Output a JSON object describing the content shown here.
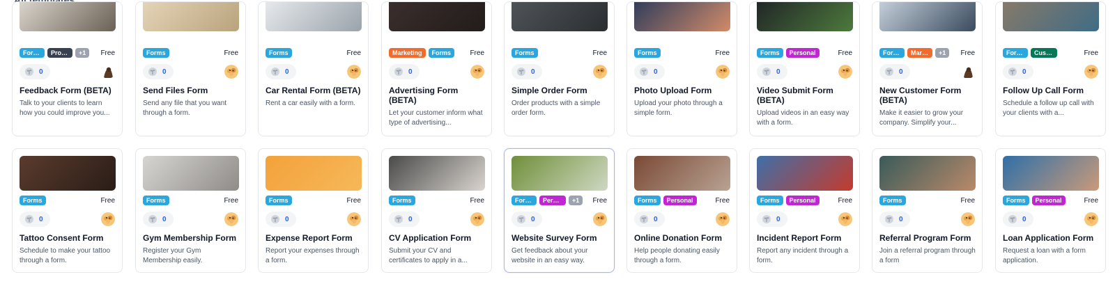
{
  "section_title": "All templates",
  "clone_icon": "sprout-icon",
  "rows": [
    {
      "cards": [
        {
          "name": "feedback-form",
          "title": "Feedback Form (BETA)",
          "desc": "Talk to your clients to learn how you could improve you...",
          "tags": [
            {
              "label": "Forms",
              "kind": "forms",
              "trunc": true
            },
            {
              "label": "Product",
              "kind": "product",
              "trunc": true
            },
            {
              "label": "+1",
              "kind": "more"
            }
          ],
          "price": "Free",
          "count": "0",
          "avatar": "dark",
          "thumb": [
            "#ded9d2",
            "#6b6154"
          ]
        },
        {
          "name": "send-files-form",
          "title": "Send Files Form",
          "desc": "Send any file that you want through a form.",
          "tags": [
            {
              "label": "Forms",
              "kind": "forms"
            }
          ],
          "price": "Free",
          "count": "0",
          "avatar": "dog",
          "thumb": [
            "#e6d6b9",
            "#b9a37d"
          ]
        },
        {
          "name": "car-rental-form",
          "title": "Car Rental Form (BETA)",
          "desc": "Rent a car easily with a form.",
          "tags": [
            {
              "label": "Forms",
              "kind": "forms"
            }
          ],
          "price": "Free",
          "count": "0",
          "avatar": "dog",
          "thumb": [
            "#e9ecef",
            "#9aa3ab"
          ]
        },
        {
          "name": "advertising-form",
          "title": "Advertising Form (BETA)",
          "desc": "Let your customer inform what type of advertising...",
          "tags": [
            {
              "label": "Marketing",
              "kind": "marketing"
            },
            {
              "label": "Forms",
              "kind": "forms"
            }
          ],
          "price": "Free",
          "count": "0",
          "avatar": "dog",
          "thumb": [
            "#3b2f2c",
            "#221c1a"
          ]
        },
        {
          "name": "simple-order-form",
          "title": "Simple Order Form",
          "desc": "Order products with a simple order form.",
          "tags": [
            {
              "label": "Forms",
              "kind": "forms"
            }
          ],
          "price": "Free",
          "count": "0",
          "avatar": "dog",
          "thumb": [
            "#50555a",
            "#2b2e31"
          ]
        },
        {
          "name": "photo-upload-form",
          "title": "Photo Upload Form",
          "desc": "Upload your photo through a simple form.",
          "tags": [
            {
              "label": "Forms",
              "kind": "forms"
            }
          ],
          "price": "Free",
          "count": "0",
          "avatar": "dog",
          "thumb": [
            "#2b3a5a",
            "#d18b6a"
          ]
        },
        {
          "name": "video-submit-form",
          "title": "Video Submit Form (BETA)",
          "desc": "Upload videos in an easy way with a form.",
          "tags": [
            {
              "label": "Forms",
              "kind": "forms"
            },
            {
              "label": "Personal",
              "kind": "personal"
            }
          ],
          "price": "Free",
          "count": "0",
          "avatar": "dog",
          "thumb": [
            "#1f2326",
            "#4d7a3c"
          ]
        },
        {
          "name": "new-customer-form",
          "title": "New Customer Form (BETA)",
          "desc": "Make it easier to grow your company. Simplify your...",
          "tags": [
            {
              "label": "Forms",
              "kind": "forms",
              "trunc": true
            },
            {
              "label": "Marketing",
              "kind": "marketing",
              "trunc": true
            },
            {
              "label": "+1",
              "kind": "more"
            }
          ],
          "price": "Free",
          "count": "0",
          "avatar": "dark",
          "thumb": [
            "#c9d4de",
            "#3a4b5e"
          ]
        },
        {
          "name": "follow-up-call-form",
          "title": "Follow Up Call Form",
          "desc": "Schedule a follow up call with your clients with a...",
          "tags": [
            {
              "label": "Forms",
              "kind": "forms",
              "trunc": true
            },
            {
              "label": "Customer Support",
              "kind": "customer",
              "trunc2": true
            }
          ],
          "price": "Free",
          "count": "0",
          "avatar": "dog",
          "thumb": [
            "#8a7a68",
            "#3f6c86"
          ]
        }
      ]
    },
    {
      "cards": [
        {
          "name": "tattoo-consent-form",
          "title": "Tattoo Consent Form",
          "desc": "Schedule to make your tattoo through a form.",
          "tags": [
            {
              "label": "Forms",
              "kind": "forms"
            }
          ],
          "price": "Free",
          "count": "0",
          "avatar": "dog",
          "thumb": [
            "#5a3b2d",
            "#2a1d17"
          ]
        },
        {
          "name": "gym-membership-form",
          "title": "Gym Membership Form",
          "desc": "Register your Gym Membership easily.",
          "tags": [
            {
              "label": "Forms",
              "kind": "forms"
            }
          ],
          "price": "Free",
          "count": "0",
          "avatar": "dog",
          "thumb": [
            "#d7d5d2",
            "#8f8c88"
          ]
        },
        {
          "name": "expense-report-form",
          "title": "Expense Report Form",
          "desc": "Report your expenses through a form.",
          "tags": [
            {
              "label": "Forms",
              "kind": "forms"
            }
          ],
          "price": "Free",
          "count": "0",
          "avatar": "dog",
          "thumb": [
            "#f3a23a",
            "#f6b85a"
          ]
        },
        {
          "name": "cv-application-form",
          "title": "CV Application Form",
          "desc": "Submit your CV and certificates to apply in a...",
          "tags": [
            {
              "label": "Forms",
              "kind": "forms"
            }
          ],
          "price": "Free",
          "count": "0",
          "avatar": "dog",
          "thumb": [
            "#4a4a4a",
            "#d9d4ce"
          ]
        },
        {
          "name": "website-survey-form",
          "title": "Website Survey Form",
          "desc": "Get feedback about your website in an easy way.",
          "tags": [
            {
              "label": "Forms",
              "kind": "forms",
              "trunc": true
            },
            {
              "label": "Personal",
              "kind": "personal",
              "trunc2": true
            },
            {
              "label": "+1",
              "kind": "more"
            }
          ],
          "price": "Free",
          "count": "0",
          "avatar": "dog",
          "thumb": [
            "#6f8f3a",
            "#cfd8c2"
          ],
          "highlight": true
        },
        {
          "name": "online-donation-form",
          "title": "Online Donation Form",
          "desc": "Help people donating easily through a form.",
          "tags": [
            {
              "label": "Forms",
              "kind": "forms"
            },
            {
              "label": "Personal",
              "kind": "personal"
            }
          ],
          "price": "Free",
          "count": "0",
          "avatar": "dog",
          "thumb": [
            "#7a4a35",
            "#b9a294"
          ]
        },
        {
          "name": "incident-report-form",
          "title": "Incident Report Form",
          "desc": "Report any incident through a form.",
          "tags": [
            {
              "label": "Forms",
              "kind": "forms"
            },
            {
              "label": "Personal",
              "kind": "personal"
            }
          ],
          "price": "Free",
          "count": "0",
          "avatar": "dog",
          "thumb": [
            "#3f6fa8",
            "#c43b2f"
          ]
        },
        {
          "name": "referral-program-form",
          "title": "Referral Program Form",
          "desc": "Join a referral program through a form",
          "tags": [
            {
              "label": "Forms",
              "kind": "forms"
            }
          ],
          "price": "Free",
          "count": "0",
          "avatar": "dog",
          "thumb": [
            "#3a5a5a",
            "#b98a6a"
          ]
        },
        {
          "name": "loan-application-form",
          "title": "Loan Application Form",
          "desc": "Request a loan with a form application.",
          "tags": [
            {
              "label": "Forms",
              "kind": "forms"
            },
            {
              "label": "Personal",
              "kind": "personal"
            }
          ],
          "price": "Free",
          "count": "0",
          "avatar": "dog",
          "thumb": [
            "#2f6fa8",
            "#c99a7a"
          ]
        }
      ]
    }
  ]
}
